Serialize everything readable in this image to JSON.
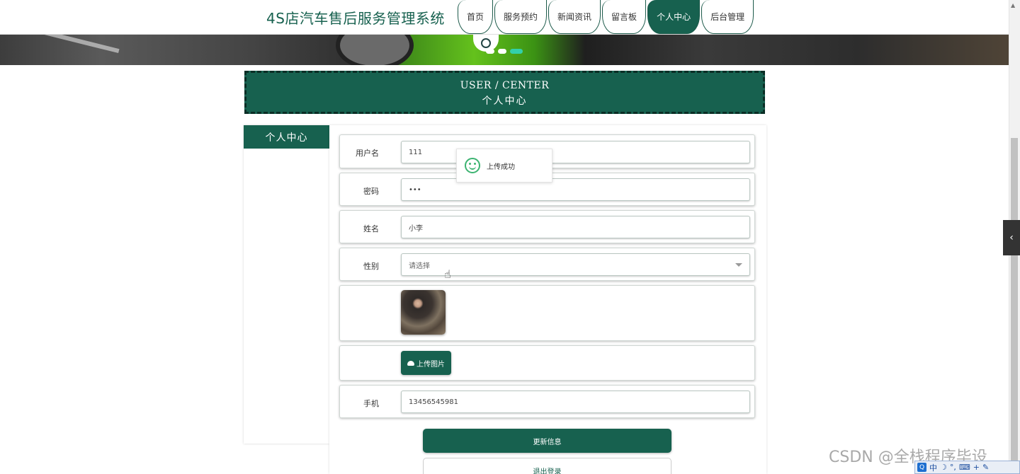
{
  "header": {
    "site_title": "4S店汽车售后服务管理系统",
    "nav": [
      {
        "label": "首页",
        "active": false
      },
      {
        "label": "服务预约",
        "active": false
      },
      {
        "label": "新闻资讯",
        "active": false
      },
      {
        "label": "留言板",
        "active": false
      },
      {
        "label": "个人中心",
        "active": true
      },
      {
        "label": "后台管理",
        "active": false
      }
    ]
  },
  "banner": {
    "slide_count": 3,
    "active_slide": 3
  },
  "page_title": {
    "en": "USER / CENTER",
    "cn": "个人中心"
  },
  "sidebar": {
    "heading": "个人中心"
  },
  "form": {
    "username": {
      "label": "用户名",
      "value": "111"
    },
    "password": {
      "label": "密码",
      "value": "•••"
    },
    "name": {
      "label": "姓名",
      "value": "小李"
    },
    "gender": {
      "label": "性别",
      "placeholder": "请选择"
    },
    "upload_button": "上传图片",
    "phone": {
      "label": "手机",
      "value": "13456545981"
    },
    "update_button": "更新信息",
    "logout_button": "退出登录"
  },
  "toast": {
    "message": "上传成功"
  },
  "watermark": "CSDN @全栈程序毕设",
  "ime": {
    "mode": "中",
    "logo": "Q"
  },
  "colors": {
    "primary": "#17614f",
    "success": "#3cb371",
    "watermark": "#8c8c8c"
  }
}
